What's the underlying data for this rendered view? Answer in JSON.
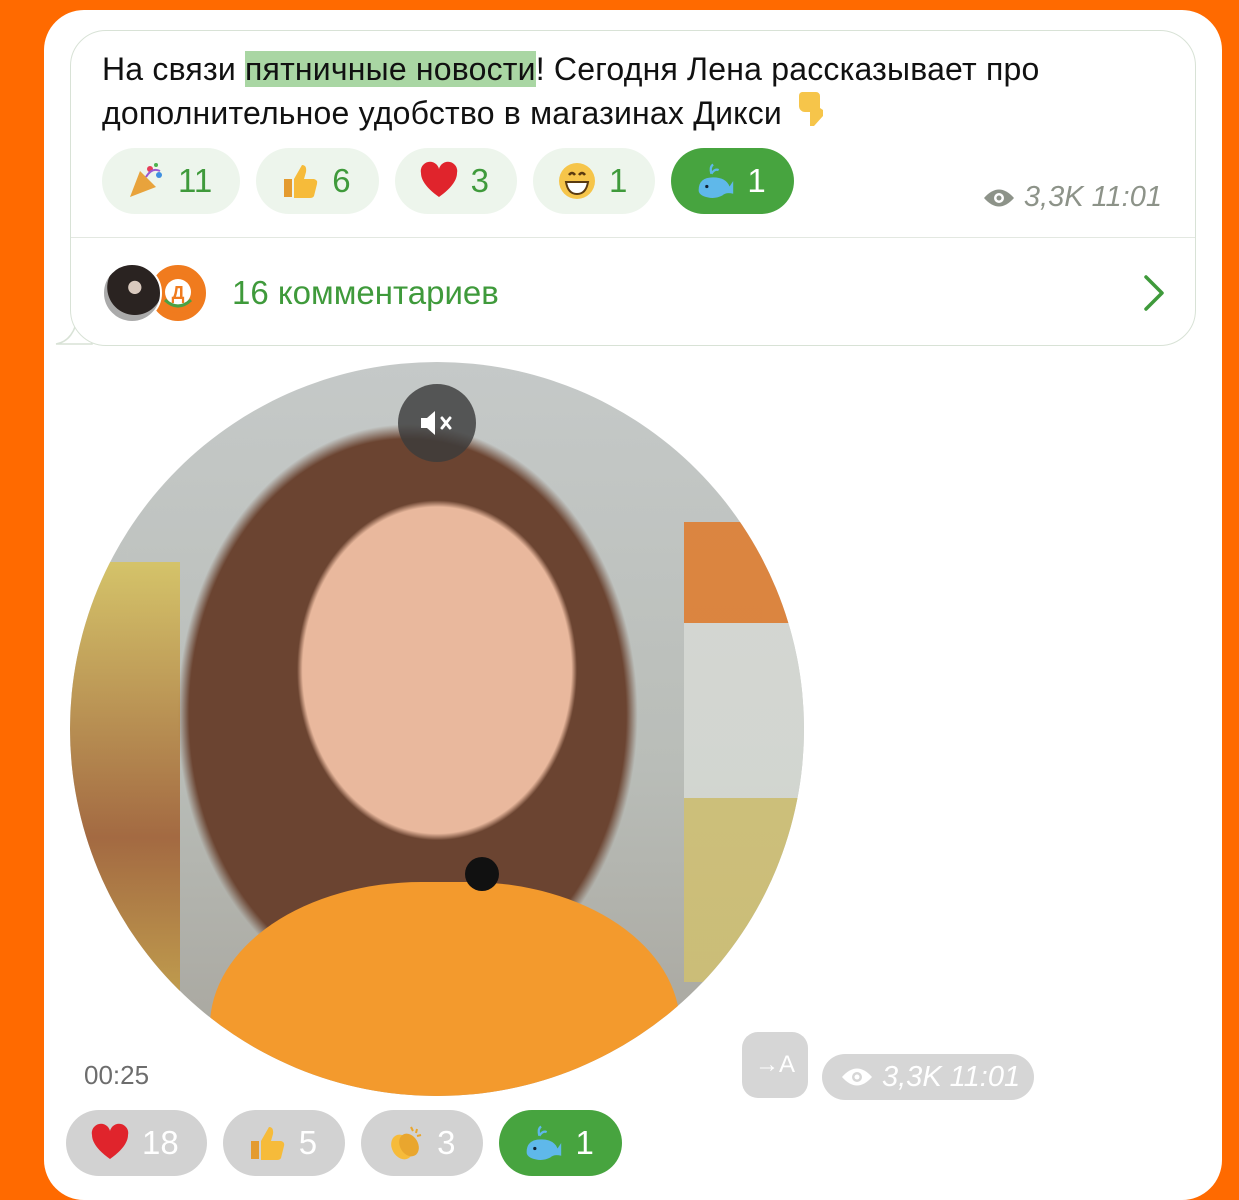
{
  "message": {
    "text_before": "На связи ",
    "highlight": "пятничные новости",
    "text_after": "! Сегодня Лена рассказывает про дополнительное удобство в магазинах Дикси"
  },
  "reactions": [
    {
      "icon": "party-popper-icon",
      "count": "11",
      "active": false
    },
    {
      "icon": "thumbs-up-icon",
      "count": "6",
      "active": false
    },
    {
      "icon": "heart-icon",
      "count": "3",
      "active": false
    },
    {
      "icon": "grinning-face-icon",
      "count": "1",
      "active": false
    },
    {
      "icon": "whale-icon",
      "count": "1",
      "active": true
    }
  ],
  "post_meta": {
    "views": "3,3K",
    "time": "11:01"
  },
  "comments": {
    "label": "16 комментариев",
    "avatar2_letter": "Д"
  },
  "video": {
    "duration": "00:25",
    "translate_label": "→A",
    "views": "3,3K",
    "time": "11:01"
  },
  "video_reactions": [
    {
      "icon": "heart-icon",
      "count": "18",
      "active": false
    },
    {
      "icon": "thumbs-up-icon",
      "count": "5",
      "active": false
    },
    {
      "icon": "clapping-hands-icon",
      "count": "3",
      "active": false
    },
    {
      "icon": "whale-icon",
      "count": "1",
      "active": true
    }
  ],
  "colors": {
    "accent": "#47a43f",
    "brand": "#ff6a00",
    "highlight": "#a9d6a3"
  }
}
